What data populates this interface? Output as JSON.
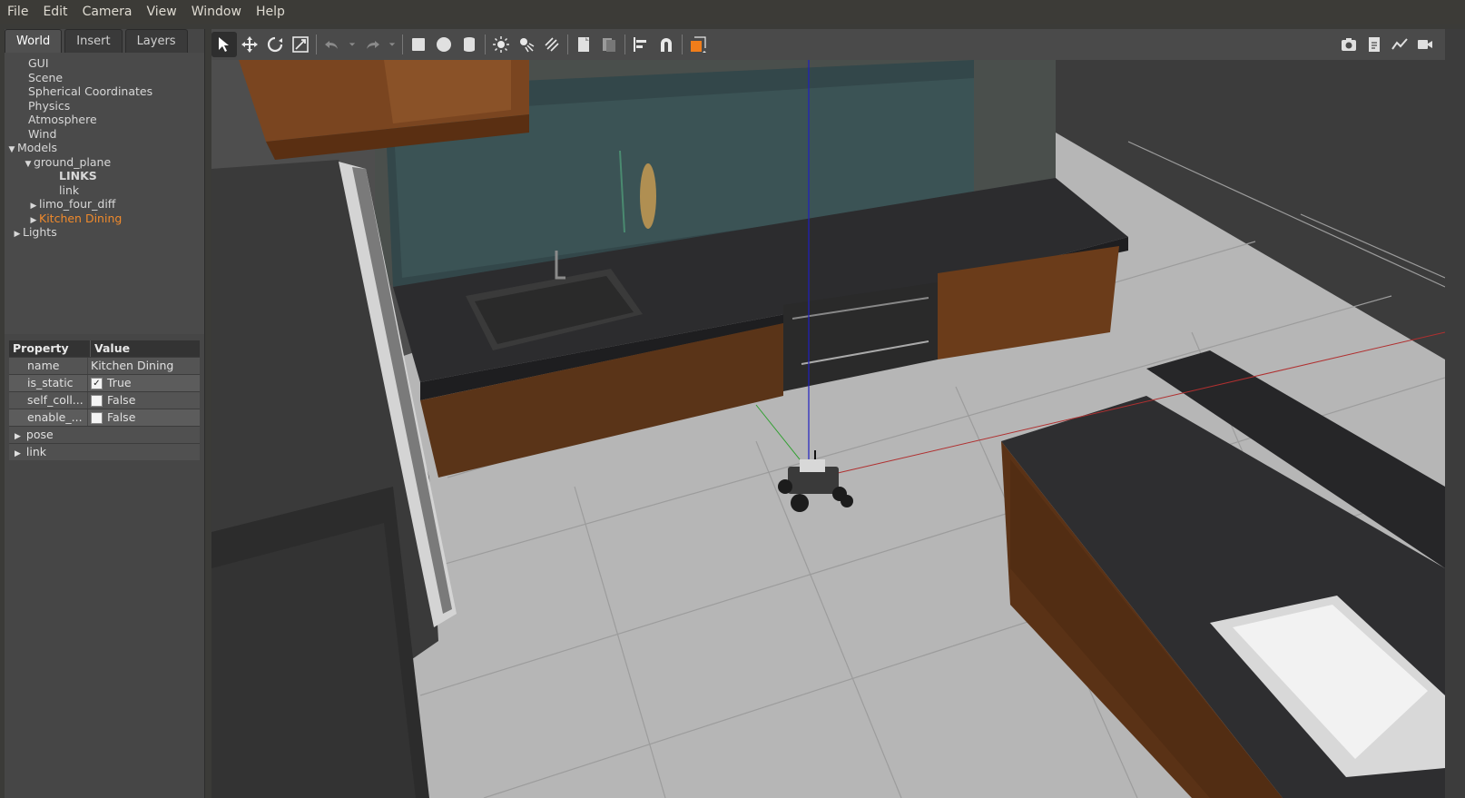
{
  "menu": {
    "items": [
      "File",
      "Edit",
      "Camera",
      "View",
      "Window",
      "Help"
    ]
  },
  "tabs": [
    {
      "label": "World",
      "active": true
    },
    {
      "label": "Insert",
      "active": false
    },
    {
      "label": "Layers",
      "active": false
    }
  ],
  "tree": {
    "gui": "GUI",
    "scene": "Scene",
    "spherical": "Spherical Coordinates",
    "physics": "Physics",
    "atmosphere": "Atmosphere",
    "wind": "Wind",
    "models": "Models",
    "ground_plane": "ground_plane",
    "links": "LINKS",
    "link": "link",
    "limo": "limo_four_diff",
    "kitchen": "Kitchen Dining",
    "lights": "Lights"
  },
  "properties": {
    "header_property": "Property",
    "header_value": "Value",
    "rows": [
      {
        "name": "name",
        "value": "Kitchen Dining",
        "checkbox": null
      },
      {
        "name": "is_static",
        "value": "True",
        "checkbox": true
      },
      {
        "name": "self_coll...",
        "value": "False",
        "checkbox": false
      },
      {
        "name": "enable_...",
        "value": "False",
        "checkbox": false
      }
    ],
    "groups": [
      "pose",
      "link"
    ]
  },
  "toolbar": {
    "left_icons": [
      "select-icon",
      "translate-icon",
      "rotate-icon",
      "scale-icon",
      "undo-icon",
      "undo-history-icon",
      "redo-icon",
      "redo-history-icon",
      "box-icon",
      "sphere-icon",
      "cylinder-icon",
      "point-light-icon",
      "spot-light-icon",
      "directional-light-icon",
      "copy-icon",
      "paste-icon",
      "align-icon",
      "snap-icon",
      "change-view-icon"
    ],
    "right_icons": [
      "screenshot-icon",
      "log-icon",
      "plot-icon",
      "record-icon"
    ]
  },
  "colors": {
    "menubar_bg": "#3c3b37",
    "panel_bg": "#464646",
    "selected_text": "#f08a2c",
    "floor": "#b4b4b4",
    "counter_top": "#2a2a2c",
    "cabinet_wood": "#6b3a1c"
  }
}
